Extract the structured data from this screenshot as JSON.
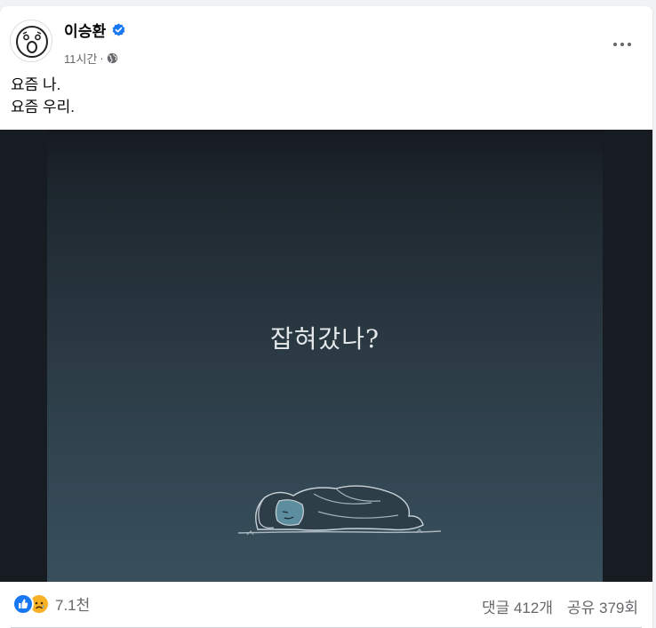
{
  "post": {
    "author": {
      "name": "이승환",
      "verified": true
    },
    "meta": {
      "time": "11시간",
      "separator": "·",
      "audience_icon": "globe-icon"
    },
    "text_lines": [
      "요즘 나.",
      "요즘 우리."
    ],
    "image": {
      "caption": "잡혀갔나?"
    },
    "reactions": {
      "icons": [
        "like-icon",
        "sad-icon"
      ],
      "count": "7.1천"
    },
    "comments": "댓글 412개",
    "shares": "공유 379회"
  },
  "colors": {
    "accent": "#1877f2",
    "secondary_text": "#65676b",
    "image_bg": "#2c3c46"
  }
}
